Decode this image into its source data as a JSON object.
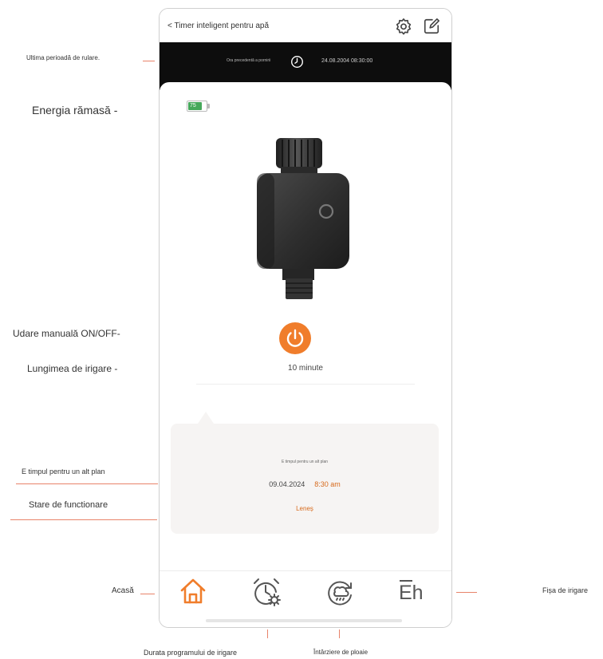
{
  "header": {
    "back_label": "< Timer inteligent pentru apă"
  },
  "last_run": {
    "label": "Ora precedentă a pornirii",
    "datetime": "24.08.2004 08:30:00"
  },
  "battery": {
    "percent": 75,
    "label": "75"
  },
  "manual": {
    "duration": "10 minute"
  },
  "schedule_panel": {
    "title": "E timpul pentru un alt plan",
    "date": "09.04.2024",
    "time": "8:30 am",
    "status": "Leneș"
  },
  "nav": {
    "record_label": "Eh"
  },
  "annotations": {
    "last_run": "Ultima perioadă de rulare.",
    "energy": "Energia rămasă -",
    "manual": "Udare manuală ON/OFF-",
    "length": "Lungimea de irigare -",
    "another_plan": "E timpul pentru un alt plan",
    "state": "Stare de functionare",
    "home": "Acasă",
    "record": "Fișa de irigare",
    "schedule": "Durata programului de irigare",
    "rain": "Întârziere de ploaie"
  },
  "colors": {
    "accent": "#f07d2b",
    "accent_text": "#d76a1c",
    "battery": "#46a85b",
    "annotation_line": "#e8836a"
  },
  "icons": {
    "back": "chevron-left-icon",
    "settings": "gear-icon",
    "edit": "edit-icon",
    "clock": "clock-icon",
    "power": "power-icon",
    "home": "home-icon",
    "schedule": "alarm-gear-icon",
    "rain": "rain-delay-icon"
  }
}
